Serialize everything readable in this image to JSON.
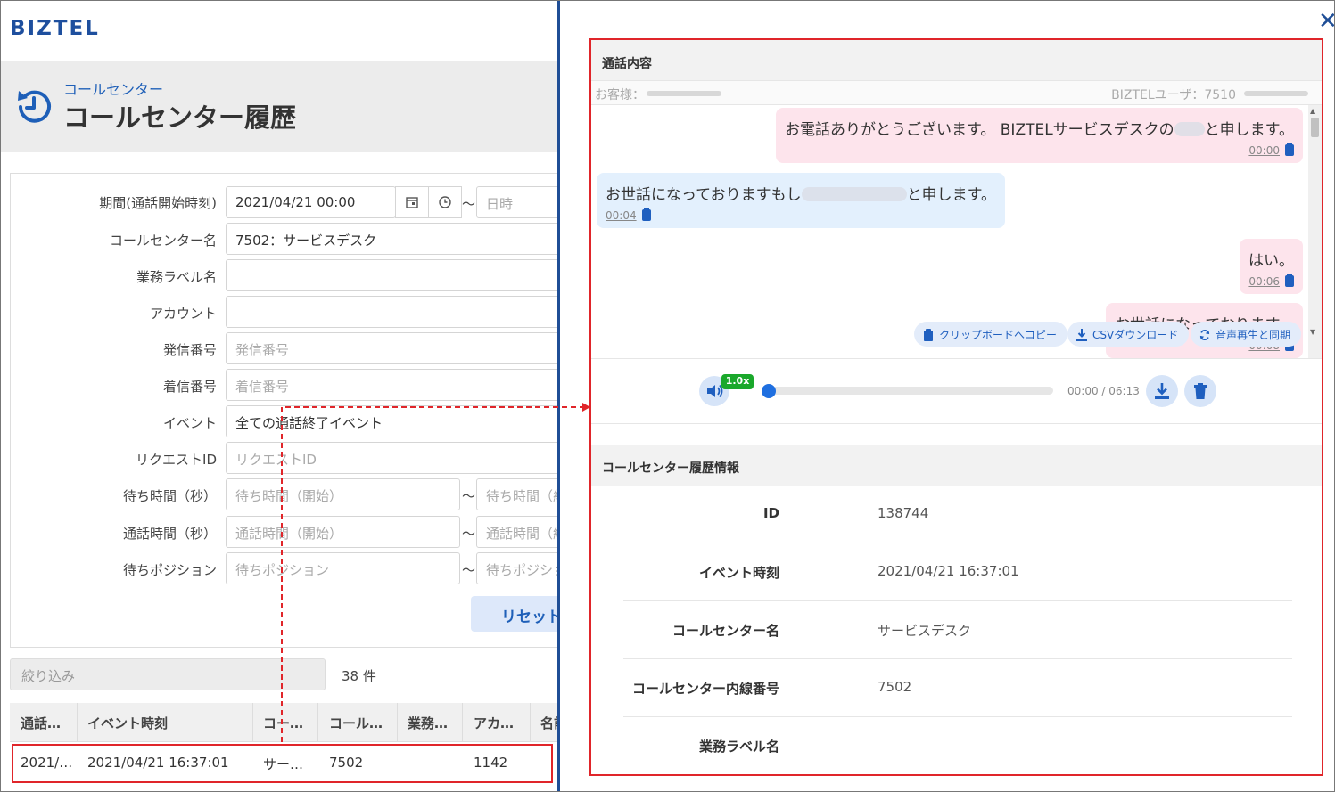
{
  "app": {
    "logo": "BIZTEL"
  },
  "page": {
    "subtitle": "コールセンター",
    "title": "コールセンター履歴"
  },
  "form": {
    "fields": [
      {
        "label": "期間(通話開始時刻)",
        "value": "2021/04/21 00:00",
        "to_placeholder": "日時"
      },
      {
        "label": "コールセンター名",
        "value": "7502：サービスデスク"
      },
      {
        "label": "業務ラベル名",
        "value": ""
      },
      {
        "label": "アカウント",
        "value": ""
      },
      {
        "label": "発信番号",
        "placeholder": "発信番号"
      },
      {
        "label": "着信番号",
        "placeholder": "着信番号"
      },
      {
        "label": "イベント",
        "value": "全ての通話終了イベント"
      },
      {
        "label": "リクエストID",
        "placeholder": "リクエストID"
      },
      {
        "label": "待ち時間（秒）",
        "from_placeholder": "待ち時間（開始）",
        "to_placeholder": "待ち時間（終"
      },
      {
        "label": "通話時間（秒）",
        "from_placeholder": "通話時間（開始）",
        "to_placeholder": "通話時間（終"
      },
      {
        "label": "待ちポジション",
        "from_placeholder": "待ちポジション",
        "to_placeholder": "待ちポジショ"
      }
    ],
    "tilde": "～",
    "reset_label": "リセット"
  },
  "filter": {
    "placeholder": "絞り込み",
    "count": "38 件"
  },
  "table": {
    "headers": [
      "通話…",
      "イベント時刻",
      "コー…",
      "コール…",
      "業務…",
      "アカ…",
      "名前"
    ],
    "row": [
      "2021/…",
      "2021/04/21 16:37:01",
      "サー…",
      "7502",
      "",
      "1142",
      ""
    ]
  },
  "detail": {
    "close": "✕",
    "call_section": "通話内容",
    "customer_label": "お客様：",
    "agent_label": "BIZTELユーザ：7510",
    "messages": [
      {
        "side": "agent",
        "text_a": "お電話ありがとうございます。 BIZTELサービスデスクの",
        "text_b": "と申します。",
        "time": "00:00"
      },
      {
        "side": "customer",
        "text_a": "お世話になっておりますもし",
        "text_b": "と申します。",
        "time": "00:04"
      },
      {
        "side": "agent",
        "text_a": "はい。",
        "text_b": "",
        "time": "00:06"
      },
      {
        "side": "agent",
        "text_a": "お世話になっております。",
        "text_b": "",
        "time": "00:08"
      }
    ],
    "buttons": {
      "copy": "クリップボードへコピー",
      "csv": "CSVダウンロード",
      "sync": "音声再生と同期"
    },
    "player": {
      "speed": "1.0x",
      "time": "00:00 / 06:13",
      "progress": 0
    },
    "info_section": "コールセンター履歴情報",
    "info": [
      {
        "key": "ID",
        "value": "138744"
      },
      {
        "key": "イベント時刻",
        "value": "2021/04/21 16:37:01"
      },
      {
        "key": "コールセンター名",
        "value": "サービスデスク"
      },
      {
        "key": "コールセンター内線番号",
        "value": "7502"
      },
      {
        "key": "業務ラベル名",
        "value": ""
      }
    ]
  },
  "colors": {
    "brand": "#1e4f9e",
    "accent": "#1f5fbf",
    "annotation": "#e0252a",
    "speed_badge": "#1aa82b"
  }
}
